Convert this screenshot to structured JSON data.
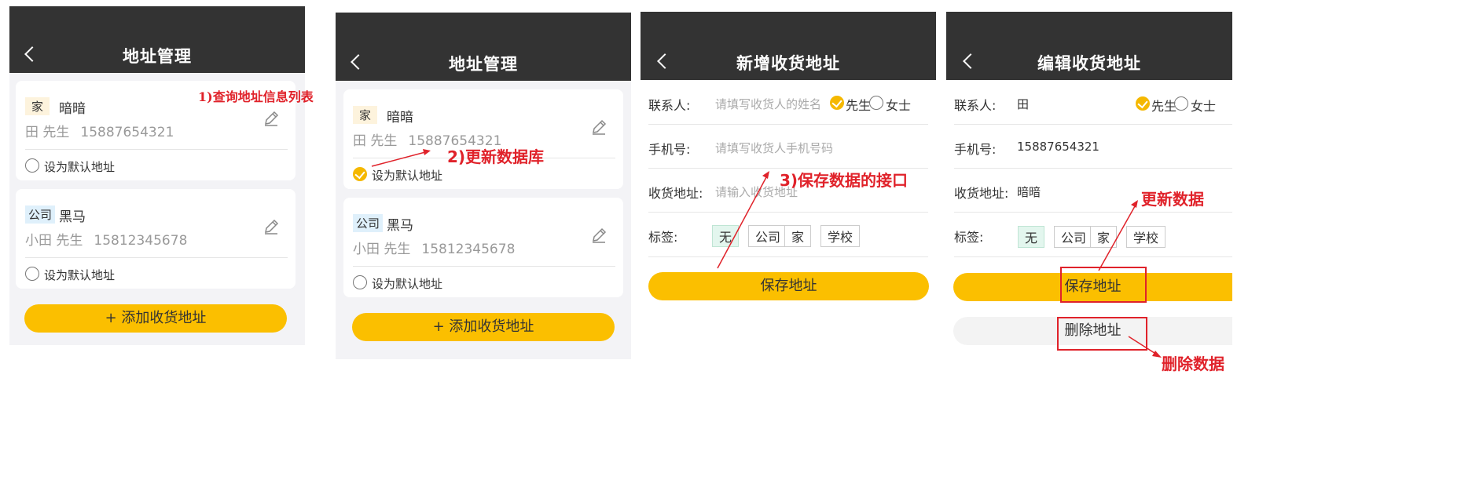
{
  "screens": [
    {
      "title": "地址管理",
      "addresses": [
        {
          "tag": "家",
          "name": "暗暗",
          "contact": "田 先生",
          "phone": "15887654321",
          "default_label": "设为默认地址",
          "is_default": false
        },
        {
          "tag": "公司",
          "name": "黑马",
          "contact": "小田 先生",
          "phone": "15812345678",
          "default_label": "设为默认地址",
          "is_default": false
        }
      ],
      "add_button": "+ 添加收货地址"
    },
    {
      "title": "地址管理",
      "addresses": [
        {
          "tag": "家",
          "name": "暗暗",
          "contact": "田 先生",
          "phone": "15887654321",
          "default_label": "设为默认地址",
          "is_default": true
        },
        {
          "tag": "公司",
          "name": "黑马",
          "contact": "小田 先生",
          "phone": "15812345678",
          "default_label": "设为默认地址",
          "is_default": false
        }
      ],
      "add_button": "+ 添加收货地址"
    },
    {
      "title": "新增收货地址",
      "contact_label": "联系人:",
      "contact_placeholder": "请填写收货人的姓名",
      "gender_male": "先生",
      "gender_female": "女士",
      "phone_label": "手机号:",
      "phone_placeholder": "请填写收货人手机号码",
      "address_label": "收货地址:",
      "address_placeholder": "请输入收货地址",
      "tag_label": "标签:",
      "tags": [
        "无",
        "公司",
        "家",
        "学校"
      ],
      "save_button": "保存地址"
    },
    {
      "title": "编辑收货地址",
      "contact_label": "联系人:",
      "contact_value": "田",
      "gender_male": "先生",
      "gender_female": "女士",
      "phone_label": "手机号:",
      "phone_value": "15887654321",
      "address_label": "收货地址:",
      "address_value": "暗暗",
      "tag_label": "标签:",
      "tags": [
        "无",
        "公司",
        "家",
        "学校"
      ],
      "save_button": "保存地址",
      "delete_button": "删除地址"
    }
  ],
  "annotations": {
    "query_list": "1)查询地址信息列表",
    "update_db": "2)更新数据库",
    "save_api": "3)保存数据的接口",
    "update_data": "更新数据",
    "delete_data": "删除数据"
  },
  "colors": {
    "header": "#333333",
    "accent": "#fbbf00",
    "annotation": "#e0222a"
  }
}
